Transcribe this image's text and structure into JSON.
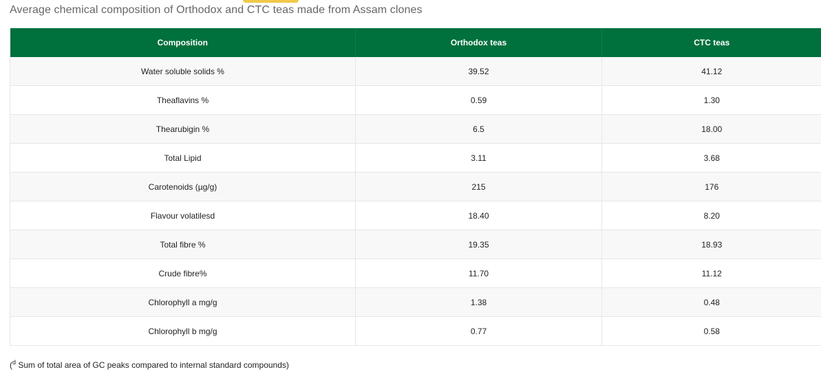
{
  "caption": "Average chemical composition of Orthodox and CTC teas made from Assam clones",
  "table": {
    "headers": [
      "Composition",
      "Orthodox teas",
      "CTC teas"
    ],
    "rows": [
      [
        "Water soluble solids %",
        "39.52",
        "41.12"
      ],
      [
        "Theaflavins %",
        "0.59",
        "1.30"
      ],
      [
        "Thearubigin %",
        "6.5",
        "18.00"
      ],
      [
        "Total Lipid",
        "3.11",
        "3.68"
      ],
      [
        "Carotenoids (µg/g)",
        "215",
        "176"
      ],
      [
        "Flavour volatilesd",
        "18.40",
        "8.20"
      ],
      [
        "Total fibre %",
        "19.35",
        "18.93"
      ],
      [
        "Crude fibre%",
        "11.70",
        "11.12"
      ],
      [
        "Chlorophyll a mg/g",
        "1.38",
        "0.48"
      ],
      [
        "Chlorophyll b mg/g",
        "0.77",
        "0.58"
      ]
    ]
  },
  "footnote": {
    "open_paren": "(",
    "marker": "d",
    "text": " Sum of total area of GC peaks compared to internal standard compounds)"
  },
  "colors": {
    "header_bg": "#00703c",
    "accent_tab": "#f1c84b"
  }
}
